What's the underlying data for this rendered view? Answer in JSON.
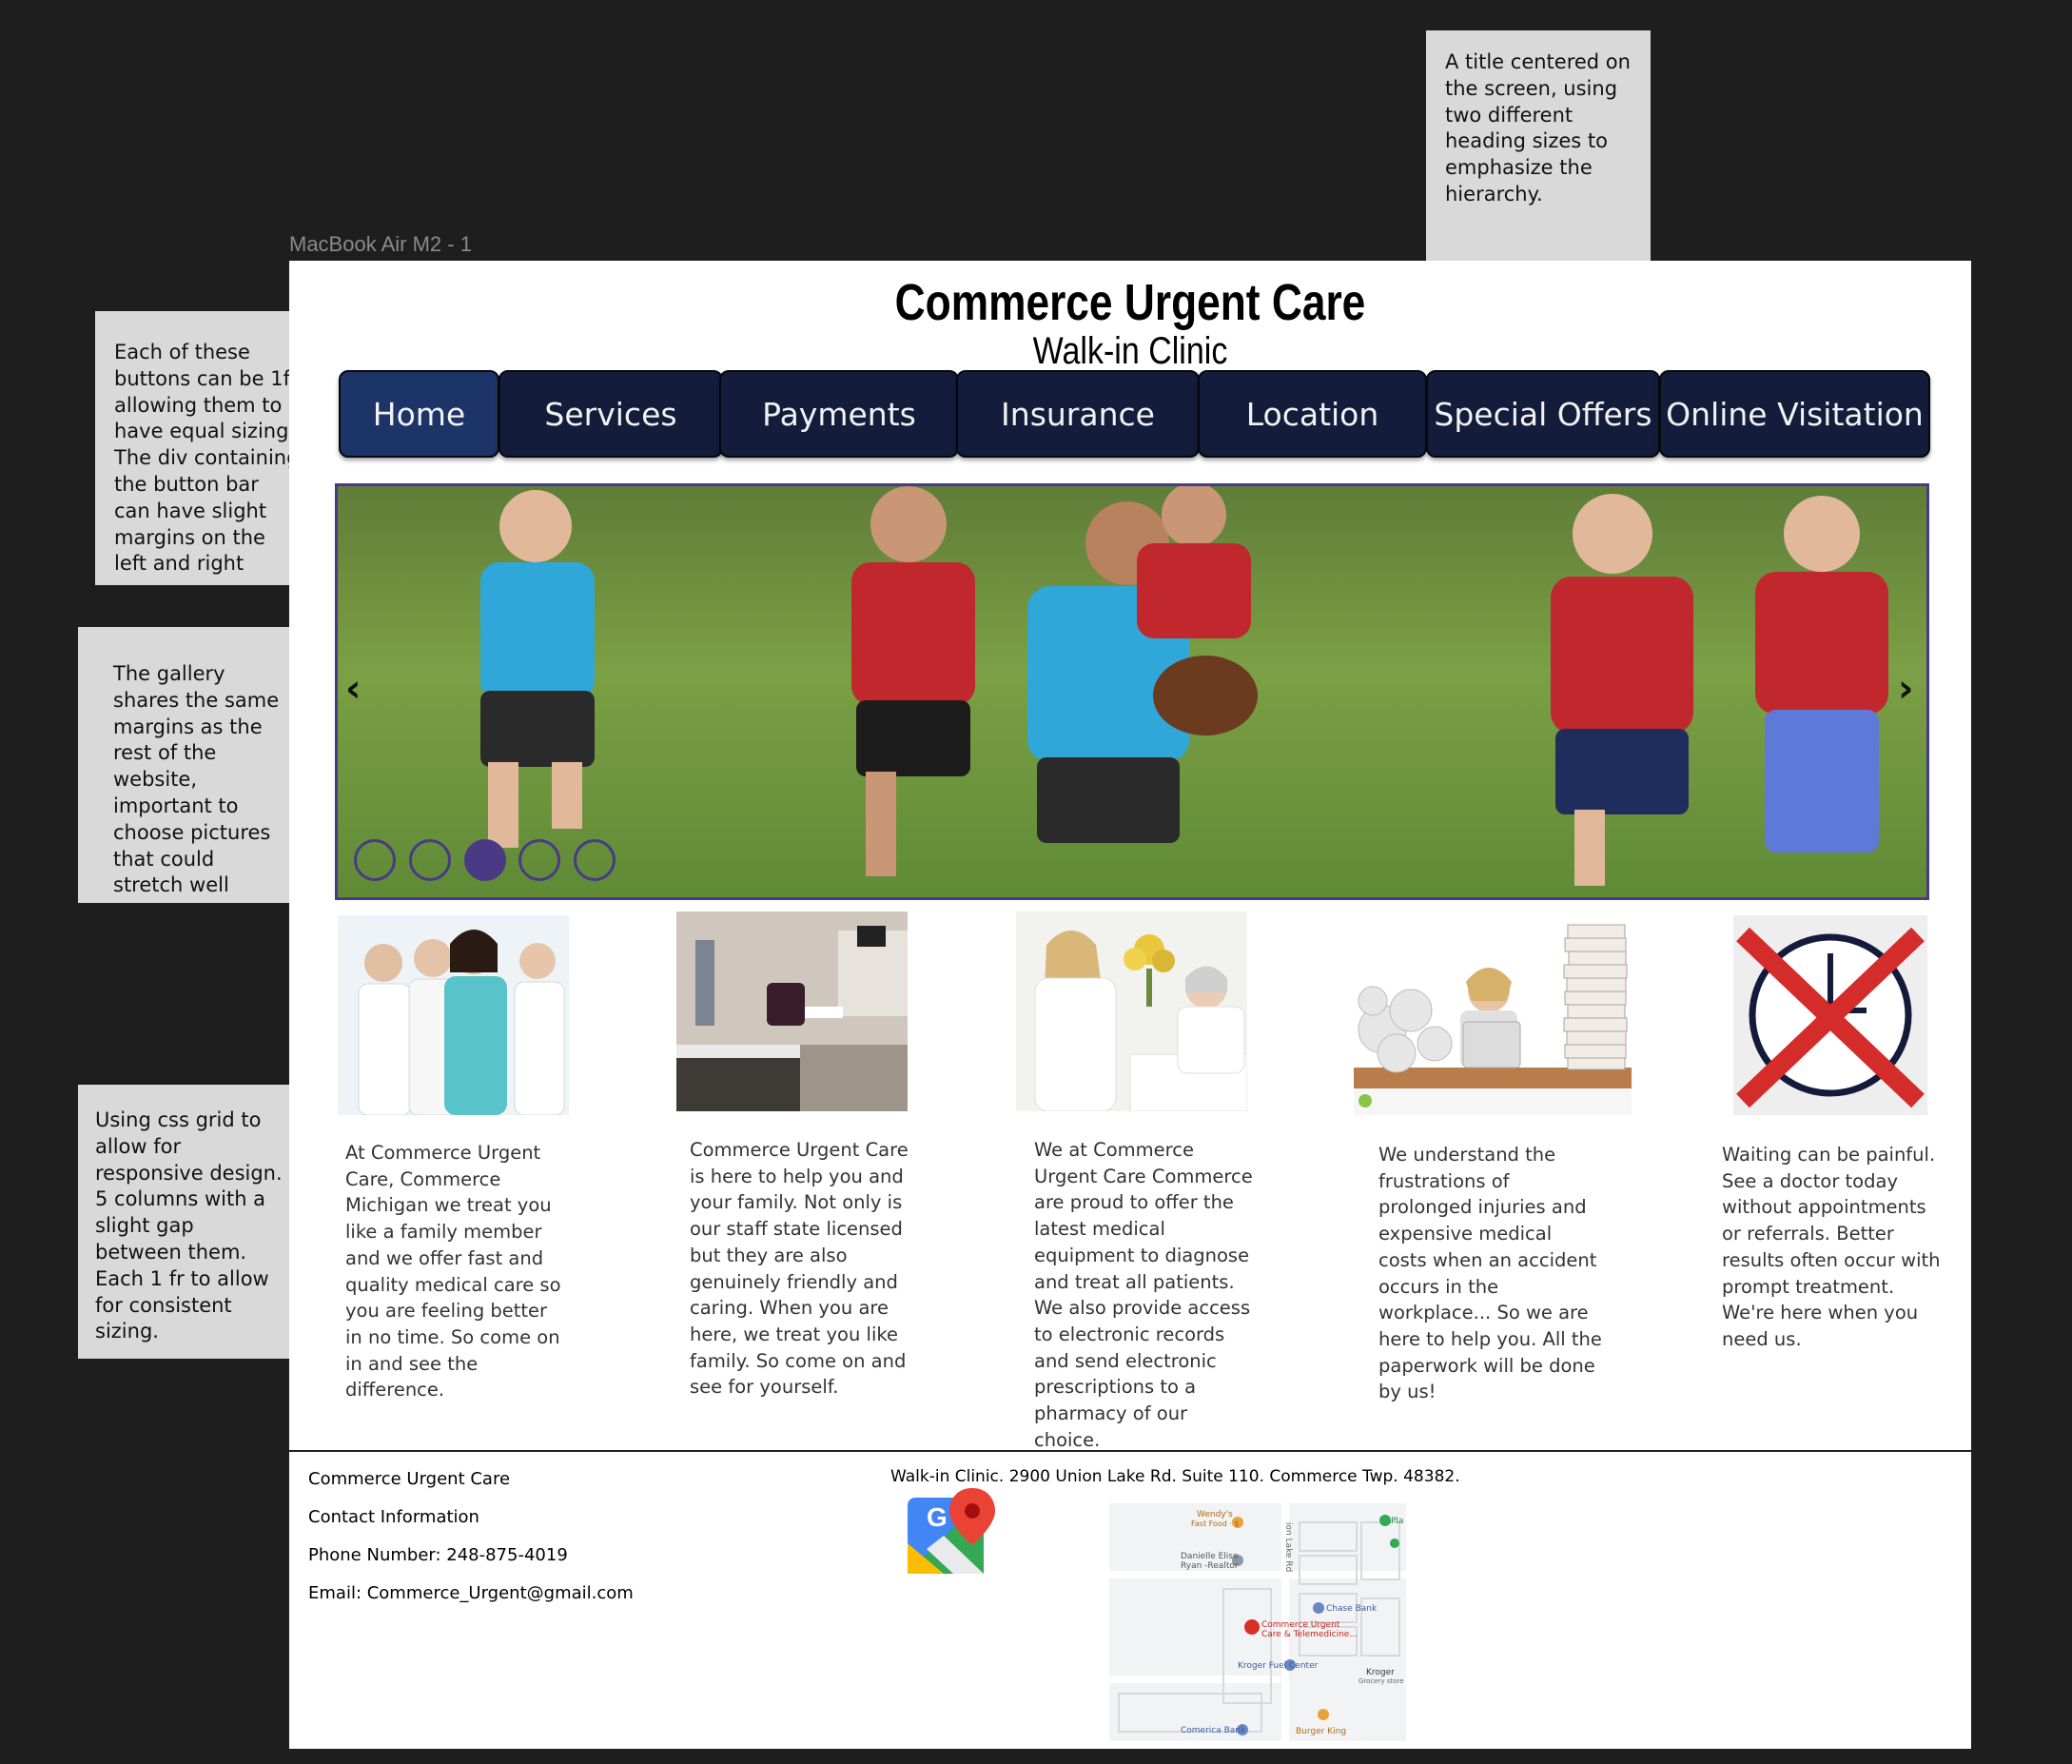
{
  "notes": {
    "title_note": "A title centered on the screen, using two different heading sizes to emphasize the hierarchy.",
    "nav_note": "Each of these buttons can be 1fr allowing them to have equal sizing. The div containing the button bar can have slight margins on the left and right",
    "gallery_note": "The gallery shares the same margins as the rest of the website, important to choose pictures that could stretch well",
    "grid_note": "Using css grid to allow for responsive design. 5 columns with a slight gap between them. Each 1 fr to allow for consistent sizing."
  },
  "frame_label": "MacBook Air M2 - 1",
  "header": {
    "title": "Commerce Urgent Care",
    "subtitle": "Walk-in Clinic"
  },
  "nav": [
    "Home",
    "Services",
    "Payments",
    "Insurance",
    "Location",
    "Special Offers",
    "Online Visitation"
  ],
  "gallery": {
    "prev_icon": "chevron-left-icon",
    "next_icon": "chevron-right-icon",
    "slide_count": 5,
    "active_slide": 3,
    "image": "kids-flag-football-photo"
  },
  "columns": [
    {
      "image": "medical-team-photo",
      "text": "At Commerce Urgent Care, Commerce Michigan we treat you like a family member and we offer fast and quality medical care so you are feeling better in no time. So come on in and see the difference."
    },
    {
      "image": "exam-room-photo",
      "text": "Commerce Urgent Care is here to help you and your family. Not only is our staff state licensed but they are also genuinely friendly and caring. When you are here, we treat you like family. So come on and see for yourself."
    },
    {
      "image": "nurse-patient-photo",
      "text": "We at Commerce Urgent Care Commerce are proud to offer the latest medical equipment to diagnose and treat all patients. We also provide access to electronic records and send electronic prescriptions to a pharmacy of our choice."
    },
    {
      "image": "stressed-paperwork-photo",
      "text": "We understand the frustrations of prolonged injuries and expensive medical costs when an accident occurs in the workplace... So we are here to help you. All the paperwork will be done by us!"
    },
    {
      "image": "crossed-clock-icon",
      "text": "Waiting can be painful. See a doctor today without appointments or referrals. Better results often occur with prompt treatment. We're here when you need us."
    }
  ],
  "footer": {
    "name": "Commerce Urgent Care",
    "contact": "Contact Information",
    "phone": "Phone Number: 248-875-4019",
    "email": "Email: Commerce_Urgent@gmail.com",
    "address": "Walk-in Clinic. 2900 Union Lake Rd. Suite 110. Commerce Twp. 48382.",
    "maps_icon": "google-maps-icon",
    "map": {
      "road": "ion Lake Rd",
      "places": [
        "Wendy's",
        "Fast Food · $",
        "Danielle Elise",
        "Ryan -Realtor",
        "Chase Bank",
        "Commerce Urgent",
        "Care & Telemedicine...",
        "Kroger Fuel Center",
        "Kroger",
        "Grocery store",
        "Comerica Bank",
        "Burger King",
        "Pla"
      ]
    }
  }
}
